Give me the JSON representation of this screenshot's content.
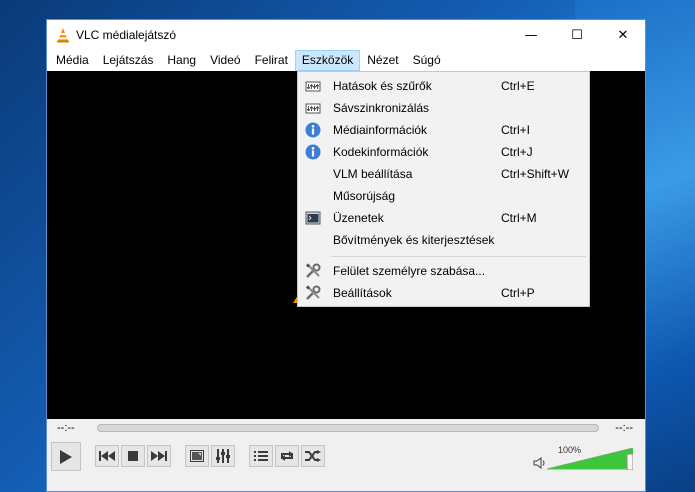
{
  "window": {
    "title": "VLC médialejátszó",
    "minimize_glyph": "—",
    "maximize_glyph": "☐",
    "close_glyph": "✕"
  },
  "menubar": {
    "items": [
      {
        "label": "Média"
      },
      {
        "label": "Lejátszás"
      },
      {
        "label": "Hang"
      },
      {
        "label": "Videó"
      },
      {
        "label": "Felirat"
      },
      {
        "label": "Eszközök",
        "active": true
      },
      {
        "label": "Nézet"
      },
      {
        "label": "Súgó"
      }
    ]
  },
  "tools_menu": {
    "items": [
      {
        "label": "Hatások és szűrők",
        "shortcut": "Ctrl+E",
        "icon": "equalizer-icon"
      },
      {
        "label": "Sávszinkronizálás",
        "shortcut": "",
        "icon": "equalizer-icon"
      },
      {
        "label": "Médiainformációk",
        "shortcut": "Ctrl+I",
        "icon": "info-icon"
      },
      {
        "label": "Kodekinformációk",
        "shortcut": "Ctrl+J",
        "icon": "info-icon"
      },
      {
        "label": "VLM beállítása",
        "shortcut": "Ctrl+Shift+W",
        "icon": ""
      },
      {
        "label": "Műsorújság",
        "shortcut": "",
        "icon": ""
      },
      {
        "label": "Üzenetek",
        "shortcut": "Ctrl+M",
        "icon": "terminal-icon"
      },
      {
        "label": "Bővítmények és kiterjesztések",
        "shortcut": "",
        "icon": ""
      },
      {
        "label": "Felület személyre szabása...",
        "shortcut": "",
        "icon": "tools-icon"
      },
      {
        "label": "Beállítások",
        "shortcut": "Ctrl+P",
        "icon": "tools-icon"
      }
    ]
  },
  "seekbar": {
    "elapsed": "--:--",
    "remaining": "--:--"
  },
  "volume": {
    "percent_label": "100%",
    "level": 1.0
  },
  "colors": {
    "accent": "#cce8ff",
    "volume_green": "#3cc63c",
    "video_bg": "#000000"
  }
}
